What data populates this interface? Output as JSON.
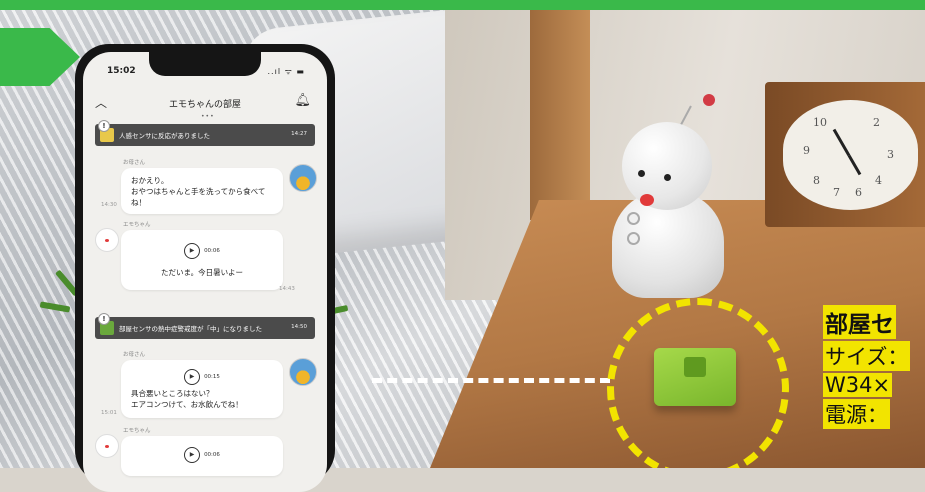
{
  "accent_color": "#3ab94a",
  "highlight_color": "#f2e400",
  "phone": {
    "status_time": "15:02",
    "status_icons": "..ıl ᯤ ▬",
    "title": "エモちゃんの部屋",
    "back_icon": "chevron-left-icon",
    "bell_icon": "bell-icon",
    "alert_1": {
      "text": "人感センサに反応がありました",
      "time": "14:27"
    },
    "msg_1": {
      "sender": "お母さん",
      "text": "おかえり。\nおやつはちゃんと手を洗ってから食べてね！",
      "time": "14:30"
    },
    "msg_2": {
      "sender": "エモちゃん",
      "duration": "00:06",
      "text": "ただいま。今日暑いよー",
      "time": "14:43"
    },
    "alert_2": {
      "text": "部屋センサの熱中症警戒度が「中」になりました",
      "time": "14:50"
    },
    "msg_3": {
      "sender": "お母さん",
      "duration": "00:15",
      "text": "具合悪いところはない？\nエアコンつけて、お水飲んでね！",
      "time": "15:01"
    },
    "msg_4": {
      "sender": "エモちゃん",
      "duration": "00:06"
    }
  },
  "spec": {
    "title": "部屋セ",
    "size_label": "サイズ：",
    "size_value": "W34×",
    "power_label": "電源："
  }
}
